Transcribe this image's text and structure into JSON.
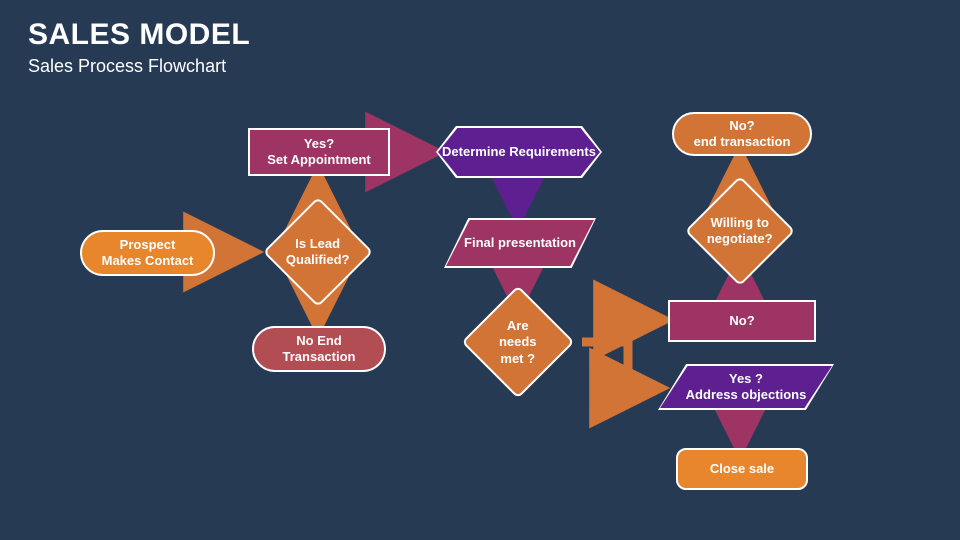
{
  "title": "SALES MODEL",
  "subtitle": "Sales Process Flowchart",
  "nodes": {
    "prospect": "Prospect\nMakes Contact",
    "qualified": "Is Lead Qualified?",
    "setAppt": "Yes?\nSet Appointment",
    "noEnd1": "No End Transaction",
    "determine": "Determine Requirements",
    "finalPres": "Final presentation",
    "needsMet": "Are needs met ?",
    "no2": "No?",
    "addressObj": "Yes ?\nAddress objections",
    "negotiate": "Willing to negotiate?",
    "noEnd2": "No?\nend transaction",
    "closeSale": "Close sale"
  },
  "colors": {
    "bg": "#273a54",
    "orange": "#e8862d",
    "orange2": "#d17436",
    "plum": "#9e3463",
    "purple": "#5e1f90",
    "brick": "#b24d54"
  }
}
